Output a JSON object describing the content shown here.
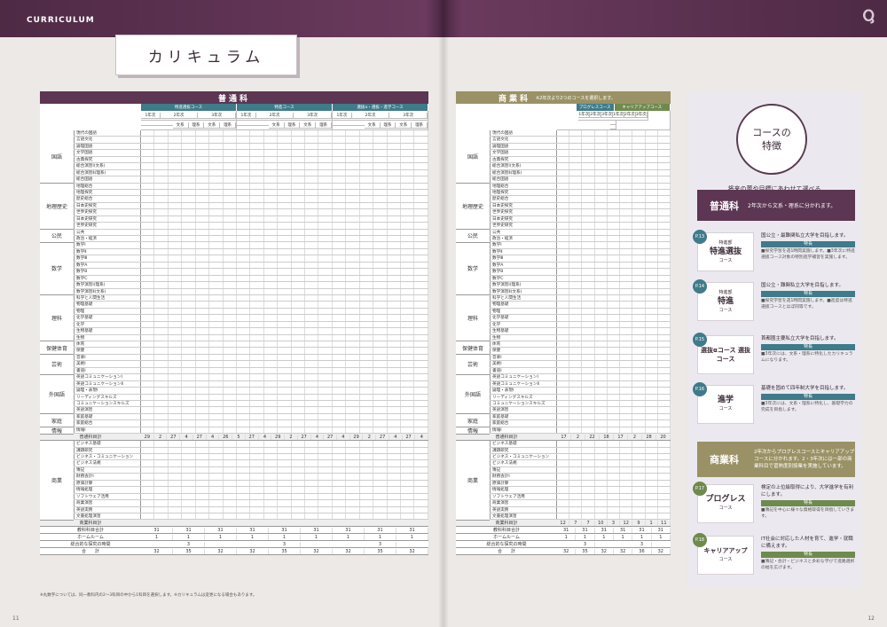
{
  "header": {
    "label": "CURRICULUM",
    "title": "カリキュラム"
  },
  "left": {
    "band": "普通科",
    "courses": [
      "特進選抜コース",
      "特進コース",
      "選抜α・選抜・進学コース"
    ],
    "years": [
      "1年次",
      "2年次",
      "3年次",
      "1年次",
      "2年次",
      "3年次",
      "1年次",
      "2年次",
      "3年次"
    ],
    "tracks": [
      "文系",
      "理系",
      "文系",
      "理系",
      "文系",
      "理系",
      "文系",
      "理系",
      "文系",
      "理系",
      "文系",
      "理系"
    ],
    "groups": [
      {
        "name": "国語",
        "subjects": [
          "現代の国語",
          "言語文化",
          "論理国語",
          "文学国語",
          "古典探究",
          "総合演習Ⅰ(文系)",
          "総合演習Ⅱ(理系)",
          "総合国語"
        ]
      },
      {
        "name": "地理歴史",
        "subjects": [
          "地理総合",
          "地理探究",
          "歴史総合",
          "日本史探究",
          "世界史探究",
          "日本史研究",
          "世界史研究"
        ]
      },
      {
        "name": "公民",
        "subjects": [
          "公共",
          "政治・経済"
        ]
      },
      {
        "name": "数学",
        "subjects": [
          "数学Ⅰ",
          "数学Ⅱ",
          "数学Ⅲ",
          "数学A",
          "数学B",
          "数学C",
          "数学演習Ⅰ(理系)",
          "数学演習Ⅱ(文系)"
        ]
      },
      {
        "name": "理科",
        "subjects": [
          "科学と人間生活",
          "物理基礎",
          "物理",
          "化学基礎",
          "化学",
          "生物基礎",
          "生物"
        ]
      },
      {
        "name": "保健体育",
        "subjects": [
          "体育",
          "保健"
        ]
      },
      {
        "name": "芸術",
        "subjects": [
          "音楽Ⅰ",
          "美術Ⅰ",
          "書道Ⅰ"
        ]
      },
      {
        "name": "外国語",
        "subjects": [
          "英語コミュニケーションⅠ",
          "英語コミュニケーションⅡ",
          "論理・表現Ⅰ",
          "リーディングスキルズ",
          "コミュニケーションスキルズ",
          "英語演習"
        ]
      },
      {
        "name": "家庭",
        "subjects": [
          "家庭基礎",
          "家庭総合"
        ]
      },
      {
        "name": "情報",
        "subjects": [
          "情報Ⅰ"
        ]
      }
    ],
    "subtotal_label": "普通科目計",
    "subtotal": [
      "29",
      "2",
      "27",
      "4",
      "27",
      "4",
      "26",
      "5",
      "27",
      "4",
      "29",
      "2",
      "27",
      "4",
      "27",
      "4",
      "29",
      "2",
      "27",
      "4",
      "27",
      "4"
    ],
    "shogyo_group": "商業",
    "shogyo_subjects": [
      "ビジネス基礎",
      "課題研究",
      "ビジネス・コミュニケーション",
      "ビジネス法規",
      "簿記",
      "財務会計Ⅰ",
      "原価計算",
      "情報処理",
      "ソフトウェア活用",
      "商業演習",
      "英語実務",
      "文書処理演習"
    ],
    "shogyo_total": "商業科目計",
    "totals": [
      {
        "label": "教科科目合計",
        "values": [
          "31",
          "31",
          "31",
          "31",
          "31",
          "31",
          "31",
          "31",
          "31"
        ]
      },
      {
        "label": "ホームルーム",
        "values": [
          "1",
          "1",
          "1",
          "1",
          "1",
          "1",
          "1",
          "1",
          "1"
        ]
      },
      {
        "label": "総合的な探究の時間",
        "values": [
          "",
          "3",
          "",
          "",
          "3",
          "",
          "",
          "3",
          ""
        ]
      },
      {
        "label": "合　　計",
        "values": [
          "32",
          "35",
          "32",
          "32",
          "35",
          "32",
          "32",
          "35",
          "32"
        ]
      }
    ],
    "note": "※丸数字については、同一教科内の2～3科目の中から1科目を選択します。※カリキュラムは変更になる場合もあります。",
    "page": "11"
  },
  "right": {
    "band": "商業科",
    "band_note": "※2年次より2つのコースを選択します。",
    "courses": [
      "プログレスコース",
      "キャリアアップコース"
    ],
    "years": [
      "1年次",
      "2年次",
      "3年次",
      "1年次",
      "2年次",
      "3年次"
    ],
    "subtotal_label": "普通科目計",
    "subtotal": [
      "17",
      "2",
      "22",
      "18",
      "17",
      "2",
      "28",
      "20"
    ],
    "shogyo_total": "商業科目計",
    "shogyo_total_values": [
      "12",
      "7",
      "7",
      "10",
      "3",
      "12",
      "9",
      "1",
      "11"
    ],
    "totals": [
      {
        "label": "教科科目合計",
        "values": [
          "31",
          "31",
          "31",
          "31",
          "31",
          "31"
        ]
      },
      {
        "label": "ホームルーム",
        "values": [
          "1",
          "1",
          "1",
          "1",
          "1",
          "1"
        ]
      },
      {
        "label": "総合的な探究の時間",
        "values": [
          "",
          "3",
          "",
          "",
          "3",
          ""
        ]
      },
      {
        "label": "合　　計",
        "values": [
          "32",
          "35",
          "32",
          "32",
          "36",
          "32"
        ]
      }
    ],
    "page": "12"
  },
  "side": {
    "circle": [
      "コースの",
      "特徴"
    ],
    "tagline": "将来の夢や目標にあわせて選べる\n7つのコース",
    "futsu": {
      "name": "普通科",
      "desc": "2年次から文系・理系に分かれます。"
    },
    "shogyo": {
      "name": "商業科",
      "desc": "2年次からプログレスコースとキャリアアップコースに分かれます。2・3年次には一部の商業科目で習熟度別授業を実施しています。"
    },
    "cards": [
      {
        "p": "P.13",
        "pre": "特進部",
        "name": "特進選抜",
        "sub": "コース",
        "text": "国公立・最難関私立大学を目指します。",
        "tag": "特長",
        "desc": "■探究学習を週1時間実施します。■3年次に特進選抜コース対象の特別進学補習を実施します。"
      },
      {
        "p": "P.14",
        "pre": "特進部",
        "name": "特進",
        "sub": "コース",
        "text": "国公立・難関私立大学を目指します。",
        "tag": "特長",
        "desc": "■探究学習を週1時間実施します。■進度は特進選抜コースとほぼ同等です。"
      },
      {
        "p": "P.15",
        "pre": "",
        "name": "選抜αコース 選抜コース",
        "sub": "",
        "text": "首都圏主要私立大学を目指します。",
        "tag": "特長",
        "desc": "■3年次には、文系・理系に特化したカリキュラムになります。"
      },
      {
        "p": "P.16",
        "pre": "",
        "name": "進学",
        "sub": "コース",
        "text": "基礎を固めて四年制大学を目指します。",
        "tag": "特長",
        "desc": "■3年次には、文系・理系に特化し、基礎学力の完成を目指します。"
      },
      {
        "p": "P.17",
        "pre": "",
        "name": "プログレス",
        "sub": "コース",
        "text": "検定の上位級取得により、大学進学を有利にします。",
        "tag": "特長",
        "desc": "■簿記を中心に様々な資格取得を目指していきます。"
      },
      {
        "p": "P.18",
        "pre": "",
        "name": "キャリアアップ",
        "sub": "コース",
        "text": "IT社会に対応した人材を育て、進学・就職に備えます。",
        "tag": "特長",
        "desc": "■簿記・会計・ビジネスと多彩な学びで進路選択の幅を広げます。"
      }
    ]
  },
  "colors": {
    "purple": "#5c3652",
    "teal": "#3f7b8a",
    "green": "#6e8a4d",
    "khaki": "#9a9266"
  }
}
